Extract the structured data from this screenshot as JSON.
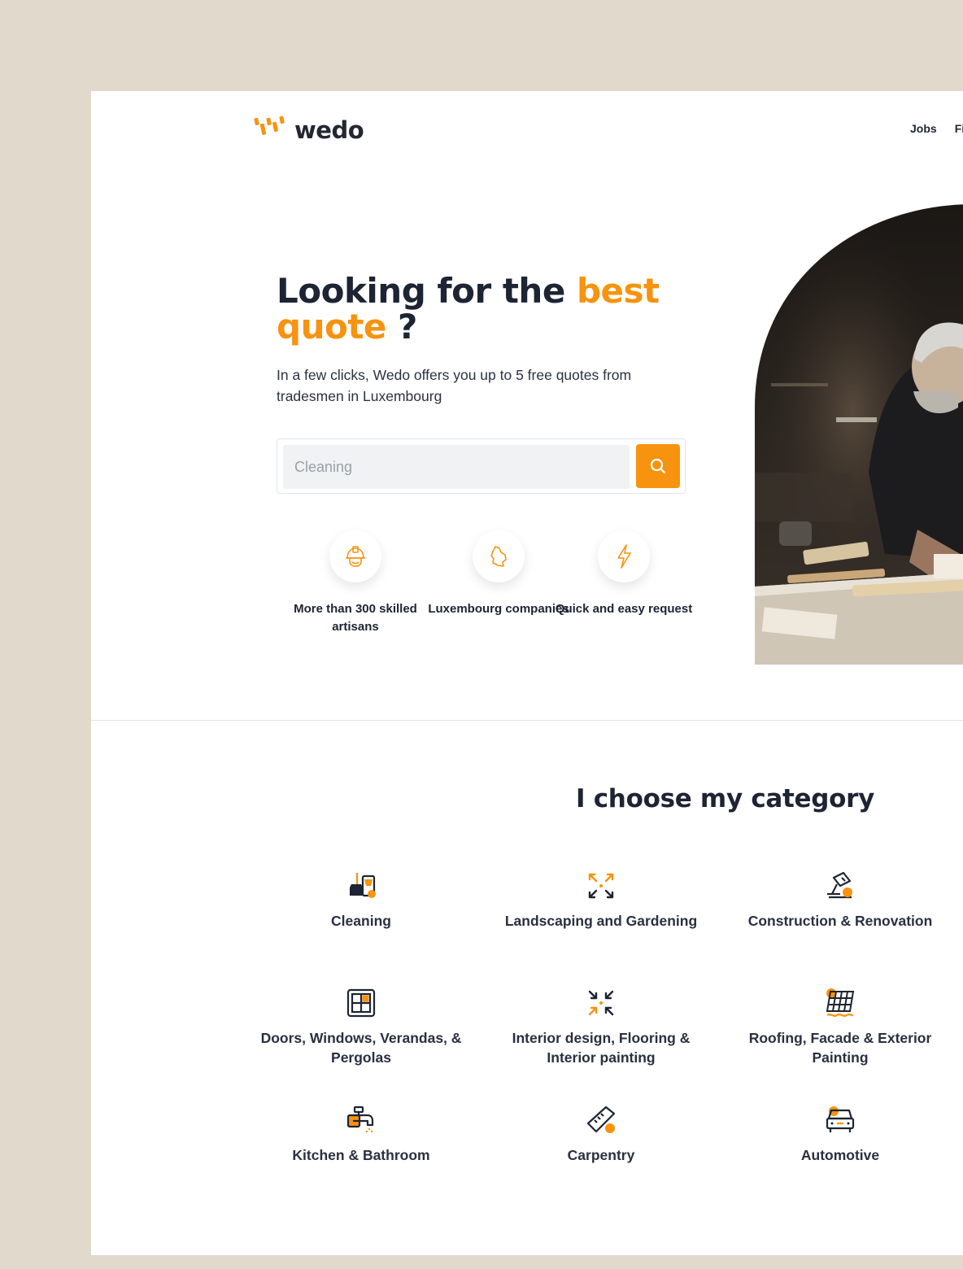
{
  "brand": {
    "name": "wedo",
    "accent_color": "#f7930e",
    "dark_color": "#1d2433"
  },
  "nav": {
    "items": [
      "Jobs",
      "Fi"
    ]
  },
  "hero": {
    "title_part1": "Looking for the",
    "title_accent1": "best",
    "title_accent2": "quote",
    "title_end": "?",
    "subtitle": "In a few clicks, Wedo offers you up to 5 free quotes from tradesmen in Luxembourg",
    "search": {
      "placeholder": "Cleaning",
      "button_icon": "search-icon"
    },
    "features": [
      {
        "icon": "helmet-icon",
        "label": "More than 300 skilled artisans"
      },
      {
        "icon": "luxembourg-map-icon",
        "label": "Luxembourg companies"
      },
      {
        "icon": "lightning-icon",
        "label": "Quick and easy request"
      }
    ]
  },
  "categories": {
    "title": "I choose my category",
    "items": [
      {
        "icon": "cleaning-icon",
        "label": "Cleaning"
      },
      {
        "icon": "landscaping-icon",
        "label": "Landscaping and Gardening"
      },
      {
        "icon": "construction-icon",
        "label": "Construction & Renovation"
      },
      {
        "icon": "window-icon",
        "label": "Doors, Windows, Verandas, & Pergolas"
      },
      {
        "icon": "interior-design-icon",
        "label": "Interior design, Flooring & Interior painting"
      },
      {
        "icon": "roofing-icon",
        "label": "Roofing, Facade & Exterior Painting"
      },
      {
        "icon": "faucet-icon",
        "label": "Kitchen & Bathroom"
      },
      {
        "icon": "carpentry-icon",
        "label": "Carpentry"
      },
      {
        "icon": "car-icon",
        "label": "Automotive"
      }
    ]
  }
}
